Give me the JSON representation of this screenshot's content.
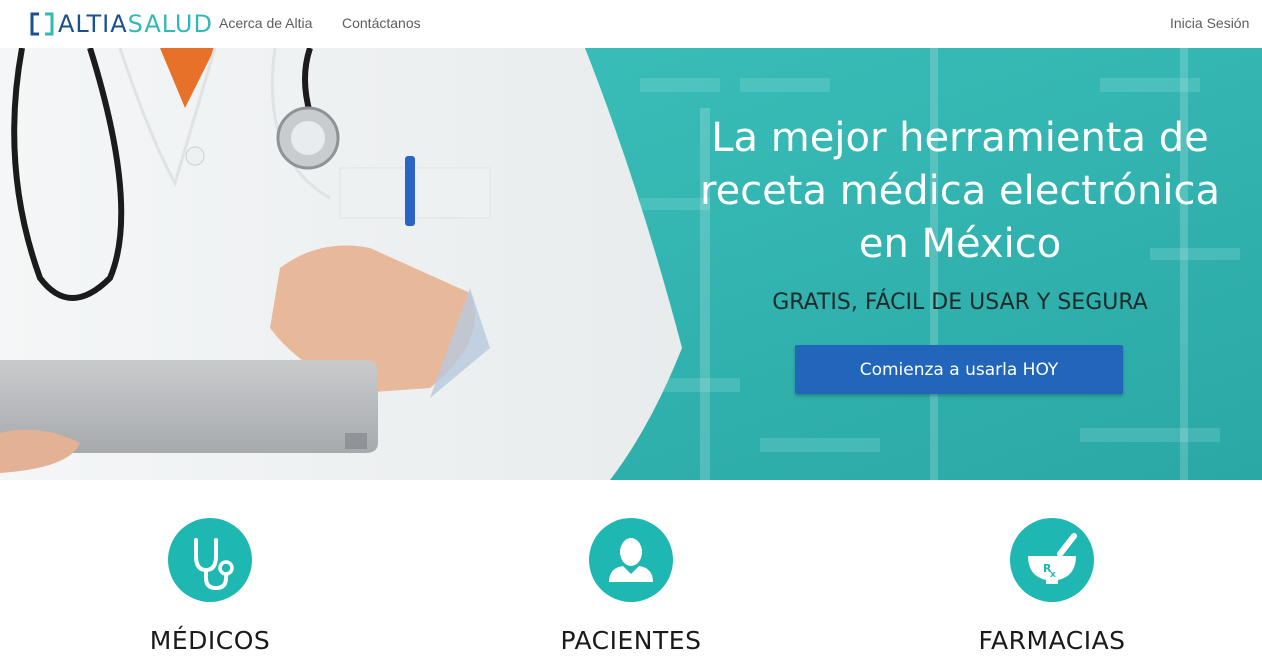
{
  "brand": {
    "part1": "ALTIA",
    "part2": "SALUD",
    "color_primary": "#1b4f8f",
    "color_accent": "#31b9b5"
  },
  "nav": {
    "links": [
      {
        "label": "Acerca de Altia"
      },
      {
        "label": "Contáctanos"
      }
    ],
    "login": "Inicia Sesión"
  },
  "hero": {
    "title": "La mejor herramienta de receta médica electrónica en México",
    "subtitle": "GRATIS, FÁCIL DE USAR Y SEGURA",
    "cta": "Comienza a usarla HOY",
    "overlay_color": "#2fb9b4",
    "button_color": "#2166bb"
  },
  "features": [
    {
      "title": "MÉDICOS",
      "icon": "stethoscope-icon"
    },
    {
      "title": "PACIENTES",
      "icon": "user-icon"
    },
    {
      "title": "FARMACIAS",
      "icon": "mortar-pestle-rx-icon"
    }
  ]
}
